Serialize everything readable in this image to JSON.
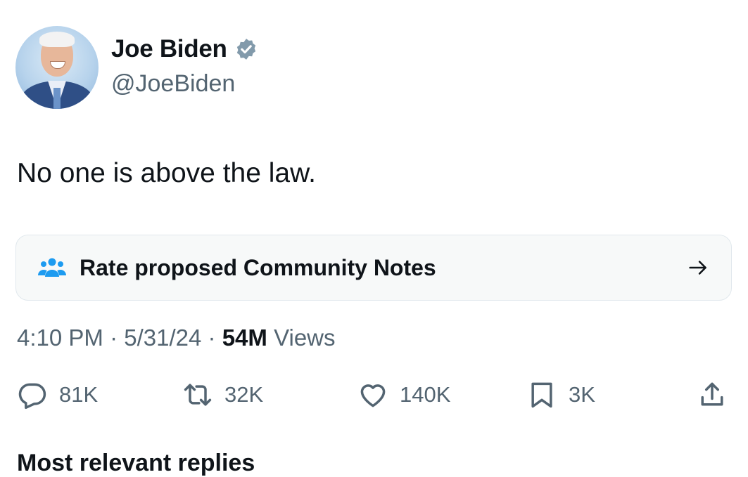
{
  "author": {
    "display_name": "Joe Biden",
    "handle": "@JoeBiden",
    "verified_icon": "verified-badge-icon",
    "verified_color": "#829aab"
  },
  "tweet": {
    "text": "No one is above the law."
  },
  "community_notes": {
    "icon": "people-group-icon",
    "icon_color": "#1d9bf0",
    "label": "Rate proposed Community Notes",
    "arrow_icon": "arrow-right-icon"
  },
  "meta": {
    "time": "4:10 PM",
    "separator": "·",
    "date": "5/31/24",
    "views_count": "54M",
    "views_label": "Views"
  },
  "actions": {
    "replies": "81K",
    "retweets": "32K",
    "likes": "140K",
    "bookmarks": "3K"
  },
  "cutoff_text": "Most relevant replies"
}
